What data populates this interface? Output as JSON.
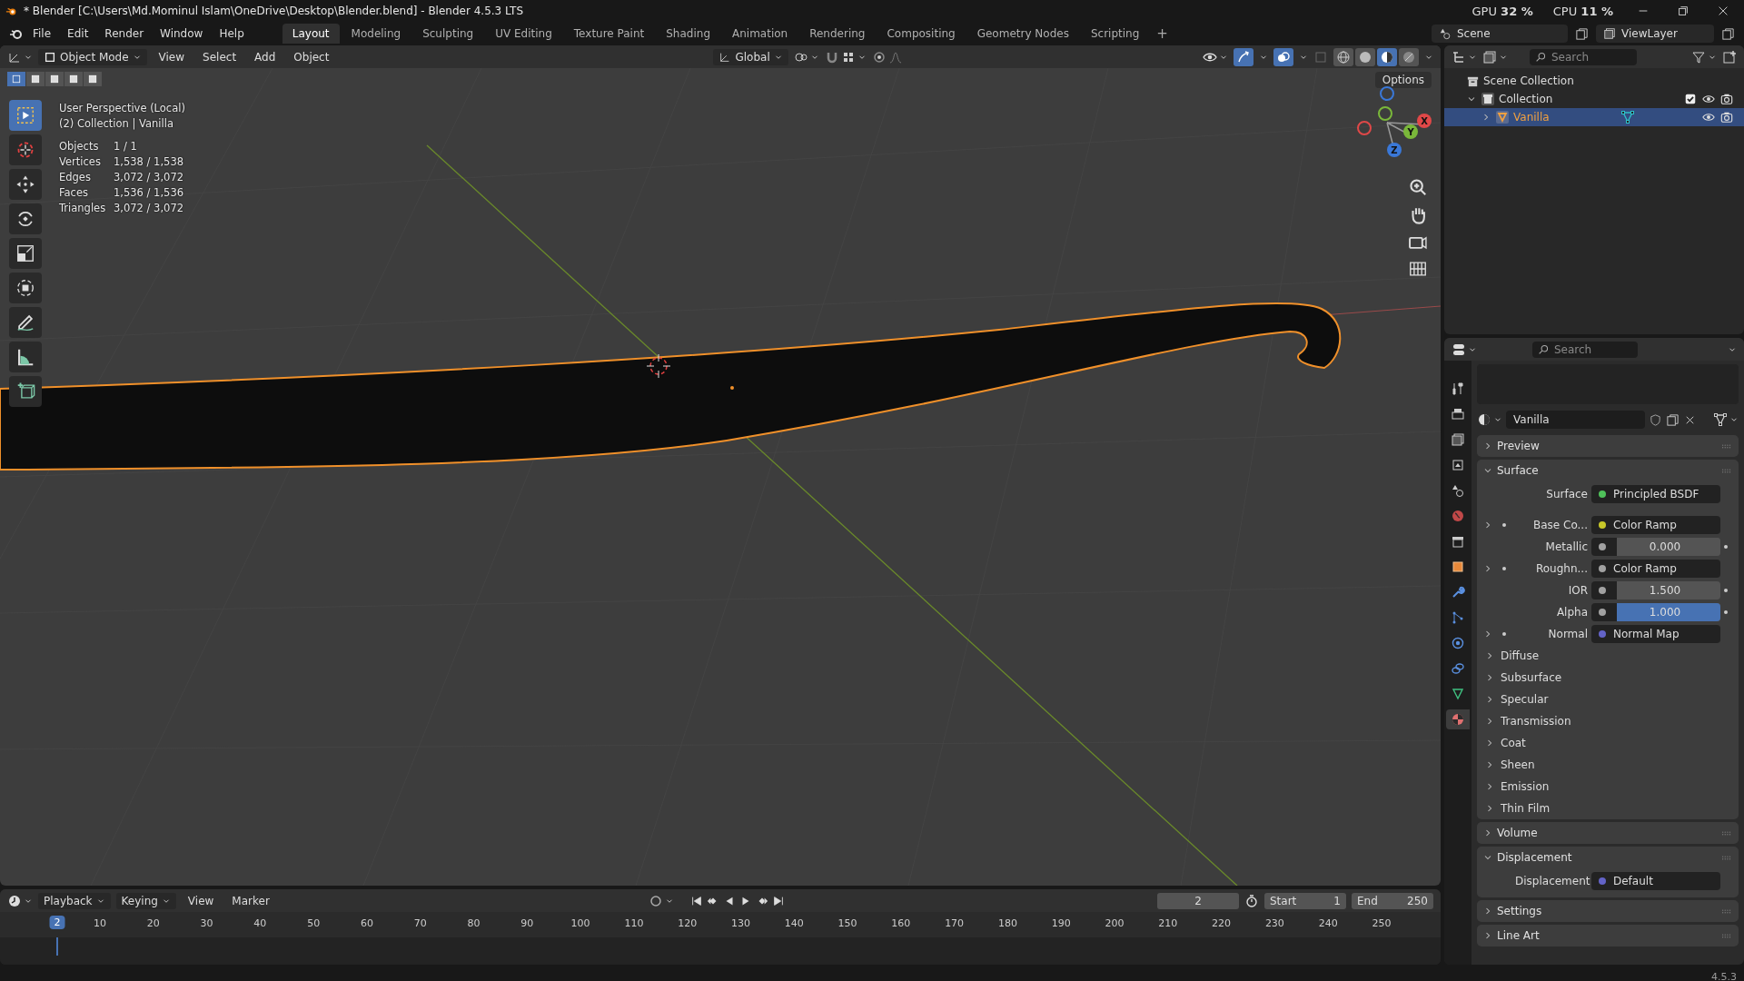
{
  "window": {
    "title": "* Blender [C:\\Users\\Md.Mominul Islam\\OneDrive\\Desktop\\Blender.blend] - Blender 4.5.3 LTS"
  },
  "monitors": [
    {
      "label": "GPU",
      "value": "32 %"
    },
    {
      "label": "CPU",
      "value": "11 %"
    }
  ],
  "menu": [
    "File",
    "Edit",
    "Render",
    "Window",
    "Help"
  ],
  "workspaces": [
    {
      "label": "Layout",
      "selected": true
    },
    {
      "label": "Modeling",
      "selected": false
    },
    {
      "label": "Sculpting",
      "selected": false
    },
    {
      "label": "UV Editing",
      "selected": false
    },
    {
      "label": "Texture Paint",
      "selected": false
    },
    {
      "label": "Shading",
      "selected": false
    },
    {
      "label": "Animation",
      "selected": false
    },
    {
      "label": "Rendering",
      "selected": false
    },
    {
      "label": "Compositing",
      "selected": false
    },
    {
      "label": "Geometry Nodes",
      "selected": false
    },
    {
      "label": "Scripting",
      "selected": false
    }
  ],
  "add_workspace": "+",
  "scene": "Scene",
  "view_layer": "ViewLayer",
  "viewport": {
    "mode": "Object Mode",
    "menus": [
      "View",
      "Select",
      "Add",
      "Object"
    ],
    "orientation": "Global",
    "options": "Options",
    "select_modes": [
      {
        "selected": true
      },
      {
        "selected": false
      },
      {
        "selected": false
      },
      {
        "selected": false
      },
      {
        "selected": false
      }
    ],
    "shading": [
      {
        "kind": "wireframe",
        "selected": false
      },
      {
        "kind": "solid",
        "selected": false
      },
      {
        "kind": "material",
        "selected": true
      },
      {
        "kind": "rendered",
        "selected": false
      }
    ],
    "tools": [
      {
        "kind": "select",
        "selected": true
      },
      {
        "kind": "cursor",
        "selected": false
      },
      {
        "kind": "move",
        "selected": false
      },
      {
        "kind": "rotate",
        "selected": false
      },
      {
        "kind": "scale",
        "selected": false
      },
      {
        "kind": "transform",
        "selected": false
      },
      {
        "kind": "annotate",
        "selected": false
      },
      {
        "kind": "measure",
        "selected": false
      },
      {
        "kind": "add-cube",
        "selected": false
      }
    ],
    "view_name": "User Perspective (Local)",
    "context": "(2) Collection | Vanilla",
    "stats": [
      {
        "label": "Objects",
        "value": "1 / 1"
      },
      {
        "label": "Vertices",
        "value": "1,538 / 1,538"
      },
      {
        "label": "Edges",
        "value": "3,072 / 3,072"
      },
      {
        "label": "Faces",
        "value": "1,536 / 1,536"
      },
      {
        "label": "Triangles",
        "value": "3,072 / 3,072"
      }
    ],
    "gizmo_axes": [
      "X",
      "Y",
      "Z"
    ]
  },
  "outliner": {
    "search_placeholder": "Search",
    "tree": [
      {
        "label": "Scene Collection",
        "kind": "scene",
        "selected": false,
        "children": [
          {
            "label": "Collection",
            "kind": "collection",
            "expanded": true,
            "checked": true,
            "selected": false,
            "children": [
              {
                "label": "Vanilla",
                "kind": "object",
                "expanded": false,
                "selected": true
              }
            ]
          }
        ]
      }
    ]
  },
  "properties": {
    "search_placeholder": "Search",
    "tabs": [
      {
        "kind": "tool",
        "selected": false
      },
      {
        "kind": "render",
        "selected": false
      },
      {
        "kind": "output",
        "selected": false
      },
      {
        "kind": "view-layer",
        "selected": false
      },
      {
        "kind": "scene",
        "selected": false
      },
      {
        "kind": "world",
        "selected": false
      },
      {
        "kind": "collection",
        "selected": false
      },
      {
        "kind": "object",
        "selected": false
      },
      {
        "kind": "modifier",
        "selected": false
      },
      {
        "kind": "particles",
        "selected": false
      },
      {
        "kind": "physics",
        "selected": false
      },
      {
        "kind": "constraints",
        "selected": false
      },
      {
        "kind": "data",
        "selected": false
      },
      {
        "kind": "material",
        "selected": true
      }
    ],
    "material": "Vanilla",
    "panels": [
      {
        "title": "Preview",
        "expanded": false
      },
      {
        "title": "Surface",
        "expanded": true,
        "rows": [
          {
            "label": "Surface",
            "kind": "link",
            "value": "Principled BSDF",
            "color": "#4fc15a",
            "expandable": false
          },
          {
            "label": "Base Co...",
            "kind": "link",
            "value": "Color Ramp",
            "color": "#c7c729",
            "expandable": true
          },
          {
            "label": "Metallic",
            "kind": "slider",
            "value": "0.000",
            "level": 0
          },
          {
            "label": "Roughn...",
            "kind": "link",
            "value": "Color Ramp",
            "color": "#a1a1a1",
            "expandable": true
          },
          {
            "label": "IOR",
            "kind": "number",
            "value": "1.500"
          },
          {
            "label": "Alpha",
            "kind": "slider",
            "value": "1.000",
            "level": 1
          },
          {
            "label": "Normal",
            "kind": "link",
            "value": "Normal Map",
            "color": "#6363c7",
            "expandable": true
          }
        ],
        "subpanels": [
          {
            "title": "Diffuse",
            "expanded": false
          },
          {
            "title": "Subsurface",
            "expanded": false
          },
          {
            "title": "Specular",
            "expanded": false
          },
          {
            "title": "Transmission",
            "expanded": false
          },
          {
            "title": "Coat",
            "expanded": false
          },
          {
            "title": "Sheen",
            "expanded": false
          },
          {
            "title": "Emission",
            "expanded": false
          },
          {
            "title": "Thin Film",
            "expanded": false
          }
        ]
      },
      {
        "title": "Volume",
        "expanded": false
      },
      {
        "title": "Displacement",
        "expanded": true,
        "rows": [
          {
            "label": "Displacement",
            "kind": "link",
            "value": "Default",
            "color": "#6363c7",
            "expandable": false
          }
        ]
      },
      {
        "title": "Settings",
        "expanded": false
      },
      {
        "title": "Line Art",
        "expanded": false
      }
    ]
  },
  "timeline": {
    "menus": [
      {
        "label": "Playback",
        "dropdown": true
      },
      {
        "label": "Keying",
        "dropdown": true
      },
      {
        "label": "View",
        "dropdown": false
      },
      {
        "label": "Marker",
        "dropdown": false
      }
    ],
    "current_frame": "2",
    "playhead_frame": "2",
    "start_label": "Start",
    "start": "1",
    "end_label": "End",
    "end": "250",
    "ruler": [
      "10",
      "20",
      "30",
      "40",
      "50",
      "60",
      "70",
      "80",
      "90",
      "100",
      "110",
      "120",
      "130",
      "140",
      "150",
      "160",
      "170",
      "180",
      "190",
      "200",
      "210",
      "220",
      "230",
      "240",
      "250"
    ]
  },
  "status_bar": {
    "version": "4.5.3"
  }
}
